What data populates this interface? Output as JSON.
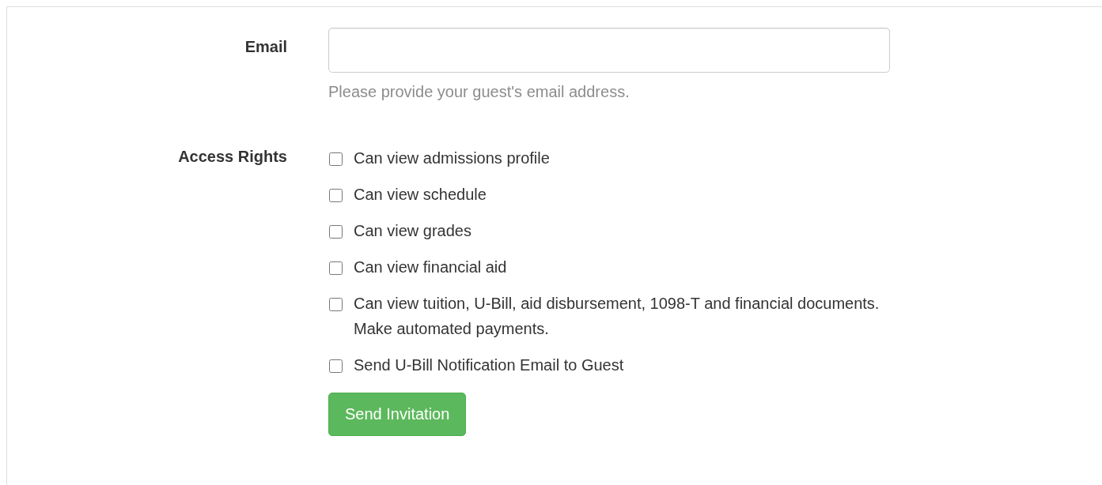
{
  "email": {
    "label": "Email",
    "help": "Please provide your guest's email address."
  },
  "access_rights": {
    "label": "Access Rights",
    "options": [
      {
        "label": "Can view admissions profile",
        "checked": false
      },
      {
        "label": "Can view schedule",
        "checked": false
      },
      {
        "label": "Can view grades",
        "checked": false
      },
      {
        "label": "Can view financial aid",
        "checked": false
      },
      {
        "label": "Can view tuition, U-Bill, aid disbursement, 1098-T and financial documents. Make automated payments.",
        "checked": false
      },
      {
        "label": "Send U-Bill Notification Email to Guest",
        "checked": false
      }
    ]
  },
  "submit_button": "Send Invitation"
}
